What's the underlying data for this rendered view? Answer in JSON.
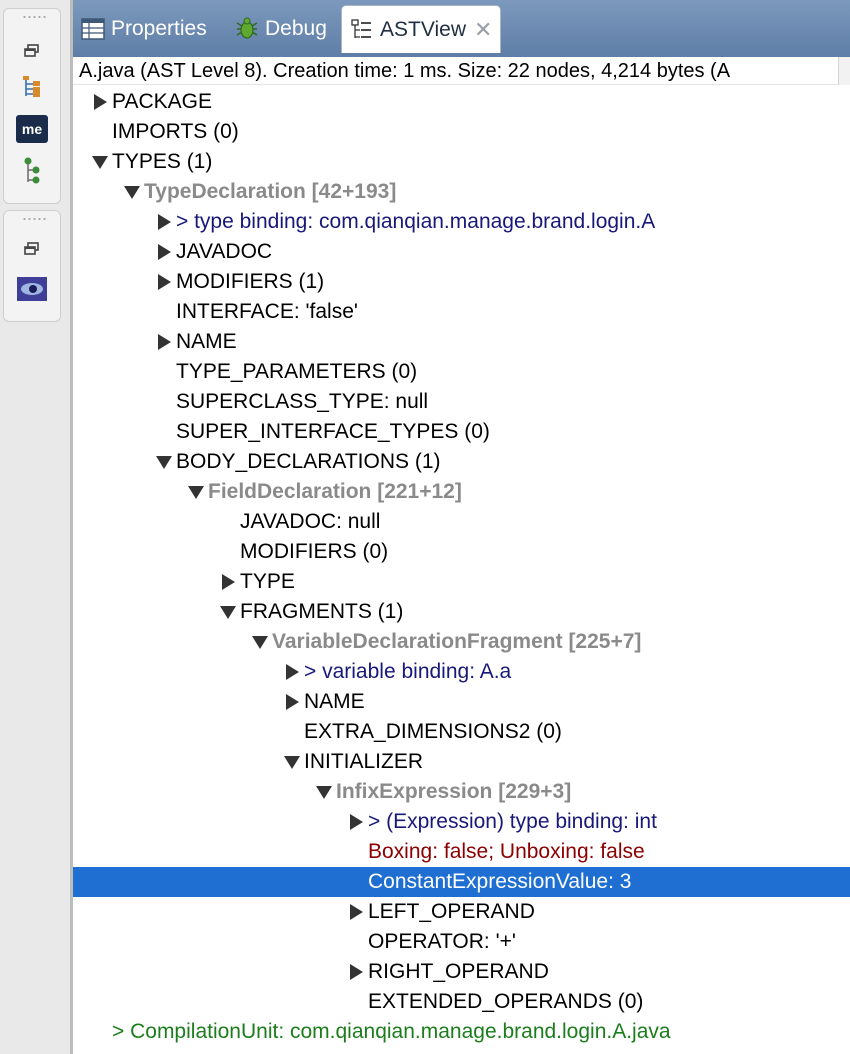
{
  "window": {
    "tabs": [
      {
        "label": "Properties",
        "icon": "properties-icon"
      },
      {
        "label": "Debug",
        "icon": "debug-bug-icon"
      },
      {
        "label": "ASTView",
        "icon": "ast-tree-icon",
        "active": true
      }
    ],
    "status": "A.java (AST Level 8).  Creation time: 1 ms.  Size: 22 nodes, 4,214 bytes (A"
  },
  "trim": {
    "group1": [
      "restore-icon",
      "hierarchy-icon",
      "me-badge-icon",
      "tree-node-icon"
    ],
    "group2": [
      "restore-icon",
      "eye-icon"
    ]
  },
  "colors": {
    "selection": "#1f6fd2",
    "binding": "#18187a",
    "warning": "#8b0000",
    "compilation_unit": "#1b7d1b",
    "node_gray": "#8a8a8a"
  },
  "tree": [
    {
      "depth": 0,
      "toggle": "collapsed",
      "label": "PACKAGE",
      "style": "plain"
    },
    {
      "depth": 0,
      "toggle": "none",
      "label": "IMPORTS (0)",
      "style": "plain"
    },
    {
      "depth": 0,
      "toggle": "expanded",
      "label": "TYPES (1)",
      "style": "plain"
    },
    {
      "depth": 1,
      "toggle": "expanded",
      "label": "TypeDeclaration [42+193]",
      "style": "node"
    },
    {
      "depth": 2,
      "toggle": "collapsed",
      "label": "> type binding: com.qianqian.manage.brand.login.A",
      "style": "binding"
    },
    {
      "depth": 2,
      "toggle": "collapsed",
      "label": "JAVADOC",
      "style": "plain"
    },
    {
      "depth": 2,
      "toggle": "collapsed",
      "label": "MODIFIERS (1)",
      "style": "plain"
    },
    {
      "depth": 2,
      "toggle": "none",
      "label": "INTERFACE: 'false'",
      "style": "plain"
    },
    {
      "depth": 2,
      "toggle": "collapsed",
      "label": "NAME",
      "style": "plain"
    },
    {
      "depth": 2,
      "toggle": "none",
      "label": "TYPE_PARAMETERS (0)",
      "style": "plain"
    },
    {
      "depth": 2,
      "toggle": "none",
      "label": "SUPERCLASS_TYPE: null",
      "style": "plain"
    },
    {
      "depth": 2,
      "toggle": "none",
      "label": "SUPER_INTERFACE_TYPES (0)",
      "style": "plain"
    },
    {
      "depth": 2,
      "toggle": "expanded",
      "label": "BODY_DECLARATIONS (1)",
      "style": "plain"
    },
    {
      "depth": 3,
      "toggle": "expanded",
      "label": "FieldDeclaration [221+12]",
      "style": "node"
    },
    {
      "depth": 4,
      "toggle": "none",
      "label": "JAVADOC: null",
      "style": "plain"
    },
    {
      "depth": 4,
      "toggle": "none",
      "label": "MODIFIERS (0)",
      "style": "plain"
    },
    {
      "depth": 4,
      "toggle": "collapsed",
      "label": "TYPE",
      "style": "plain"
    },
    {
      "depth": 4,
      "toggle": "expanded",
      "label": "FRAGMENTS (1)",
      "style": "plain"
    },
    {
      "depth": 5,
      "toggle": "expanded",
      "label": "VariableDeclarationFragment [225+7]",
      "style": "node"
    },
    {
      "depth": 6,
      "toggle": "collapsed",
      "label": "> variable binding: A.a",
      "style": "binding"
    },
    {
      "depth": 6,
      "toggle": "collapsed",
      "label": "NAME",
      "style": "plain"
    },
    {
      "depth": 6,
      "toggle": "none",
      "label": "EXTRA_DIMENSIONS2 (0)",
      "style": "plain"
    },
    {
      "depth": 6,
      "toggle": "expanded",
      "label": "INITIALIZER",
      "style": "plain"
    },
    {
      "depth": 7,
      "toggle": "expanded",
      "label": "InfixExpression [229+3]",
      "style": "node"
    },
    {
      "depth": 8,
      "toggle": "collapsed",
      "label": "> (Expression) type binding: int",
      "style": "binding"
    },
    {
      "depth": 8,
      "toggle": "none",
      "label": "Boxing: false; Unboxing: false",
      "style": "warn"
    },
    {
      "depth": 8,
      "toggle": "none",
      "label": "ConstantExpressionValue: 3",
      "style": "plain",
      "selected": true
    },
    {
      "depth": 8,
      "toggle": "collapsed",
      "label": "LEFT_OPERAND",
      "style": "plain"
    },
    {
      "depth": 8,
      "toggle": "none",
      "label": "OPERATOR: '+'",
      "style": "plain"
    },
    {
      "depth": 8,
      "toggle": "collapsed",
      "label": "RIGHT_OPERAND",
      "style": "plain"
    },
    {
      "depth": 8,
      "toggle": "none",
      "label": "EXTENDED_OPERANDS (0)",
      "style": "plain"
    },
    {
      "depth": 0,
      "toggle": "none",
      "label": "> CompilationUnit: com.qianqian.manage.brand.login.A.java",
      "style": "green"
    }
  ]
}
